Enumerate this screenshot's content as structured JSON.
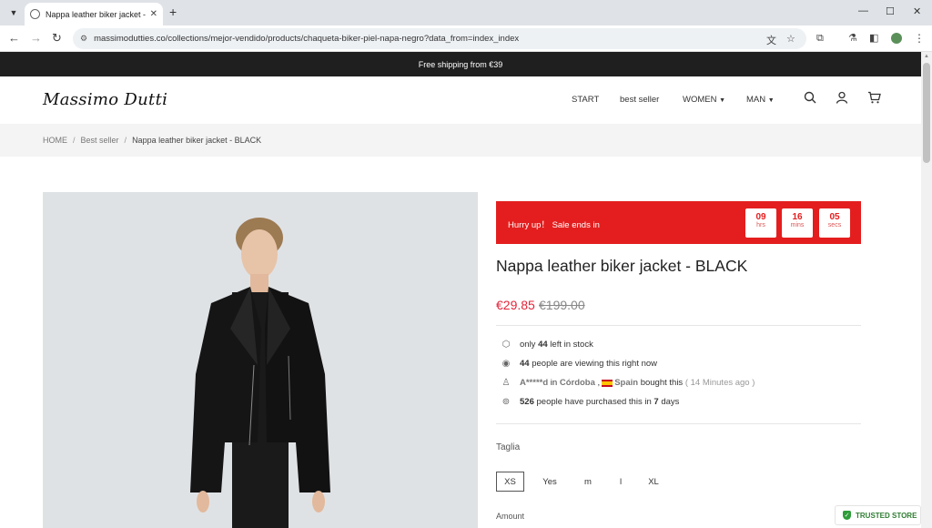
{
  "browser": {
    "tab_title": "Nappa leather biker jacket - BL",
    "tab_close": "✕",
    "new_tab": "+",
    "url": "massimodutties.co/collections/mejor-vendido/products/chaqueta-biker-piel-napa-negro?data_from=index_index",
    "window_controls": {
      "minimize": "—",
      "maximize": "☐",
      "close": "✕"
    },
    "icons": [
      "back-icon",
      "forward-icon",
      "reload-icon",
      "site-info-icon",
      "translate-icon",
      "star-icon",
      "extensions-icon",
      "labs-icon",
      "sidebar-icon",
      "profile-icon",
      "menu-icon"
    ]
  },
  "announcement": "Free shipping from €39",
  "header": {
    "logo": "Massimo Dutti",
    "nav": {
      "start": "START",
      "best_seller": "best seller",
      "women": "WOMEN",
      "man": "MAN"
    }
  },
  "breadcrumb": {
    "home": "HOME",
    "best_seller": "Best seller",
    "current": "Nappa leather biker jacket - BLACK"
  },
  "sale": {
    "label": "Hurry up！ Sale ends in",
    "hours": "09",
    "hours_unit": "hrs",
    "mins": "16",
    "mins_unit": "mins",
    "secs": "05",
    "secs_unit": "secs"
  },
  "product": {
    "title": "Nappa leather biker jacket - BLACK",
    "price_now": "€29.85",
    "price_old": "€199.00"
  },
  "info": {
    "stock_pre": "only",
    "stock_count": "44",
    "stock_post": "left in stock",
    "viewing_count": "44",
    "viewing_post": "people are viewing this right now",
    "buyer_name": "A*****d",
    "buyer_in": "in",
    "buyer_city": "Córdoba",
    "buyer_comma": ",",
    "buyer_country": "Spain",
    "buyer_bought": "bought this",
    "buyer_time": "( 14 Minutes ago )",
    "purchased_count": "526",
    "purchased_mid": "people have purchased this in",
    "purchased_days": "7",
    "purchased_post": "days"
  },
  "sizes": {
    "label": "Taglia",
    "options": [
      "XS",
      "Yes",
      "m",
      "l",
      "XL"
    ],
    "selected": "XS"
  },
  "amount_label": "Amount",
  "trusted_badge": "TRUSTED STORE",
  "colors": {
    "announcement_bg": "#1f1f1f",
    "sale_red": "#e41e1e",
    "price_red": "#e3243a",
    "trusted_green": "#2e7d32"
  }
}
